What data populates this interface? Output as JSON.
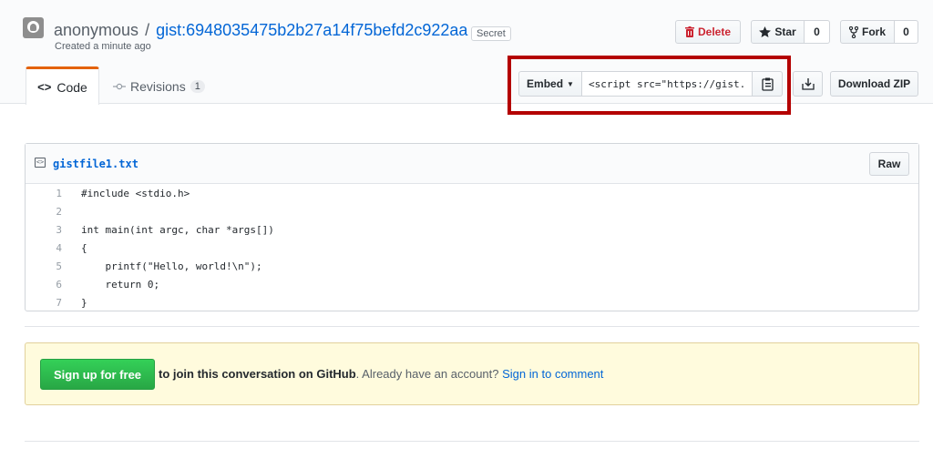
{
  "header": {
    "owner": "anonymous",
    "separator": "/",
    "gist_id": "gist:6948035475b2b27a14f75befd2c922aa",
    "visibility_badge": "Secret",
    "created": "Created a minute ago"
  },
  "actions": {
    "delete_label": "Delete",
    "star_label": "Star",
    "star_count": "0",
    "fork_label": "Fork",
    "fork_count": "0"
  },
  "tabs": {
    "code_label": "Code",
    "revisions_label": "Revisions",
    "revisions_count": "1"
  },
  "embed": {
    "label": "Embed",
    "value": "<script src=\"https://gist.",
    "download_zip": "Download ZIP"
  },
  "file": {
    "name": "gistfile1.txt",
    "raw_label": "Raw",
    "lines": [
      {
        "n": "1",
        "text": "#include <stdio.h>"
      },
      {
        "n": "2",
        "text": ""
      },
      {
        "n": "3",
        "text": "int main(int argc, char *args[])"
      },
      {
        "n": "4",
        "text": "{"
      },
      {
        "n": "5",
        "text": "    printf(\"Hello, world!\\n\");"
      },
      {
        "n": "6",
        "text": "    return 0;"
      },
      {
        "n": "7",
        "text": "}"
      }
    ]
  },
  "signup": {
    "button": "Sign up for free",
    "text_bold": "to join this conversation on GitHub",
    "text_mid": ". Already have an account? ",
    "link": "Sign in to comment"
  },
  "colors": {
    "accent_tab": "#e36209",
    "link": "#0366d6",
    "danger": "#cb2431",
    "highlight": "#b40000",
    "signup_green": "#28a745"
  }
}
